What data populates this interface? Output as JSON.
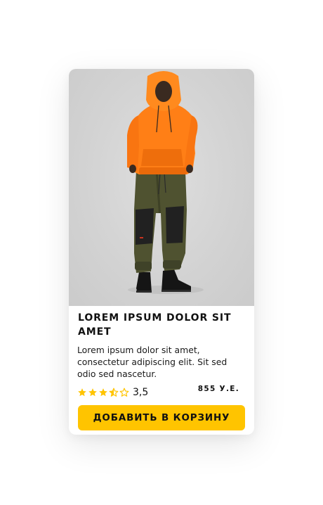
{
  "product": {
    "image_alt": "model in orange hoodie and khaki fleece pants",
    "title": "LOREM IPSUM DOLOR SIT AMET",
    "description": "Lorem ipsum dolor sit amet, consectetur adipiscing elit. Sit sed odio sed nascetur.",
    "rating": 3.5,
    "rating_label": "3,5",
    "rating_max": 5,
    "star_icon": "star-icon",
    "price": "855 У.Е.",
    "add_to_cart_label": "ДОБАВИТЬ В КОРЗИНУ"
  },
  "colors": {
    "accent": "#ffc400",
    "star": "#ffc400",
    "text": "#111111",
    "card_background": "#ffffff"
  }
}
